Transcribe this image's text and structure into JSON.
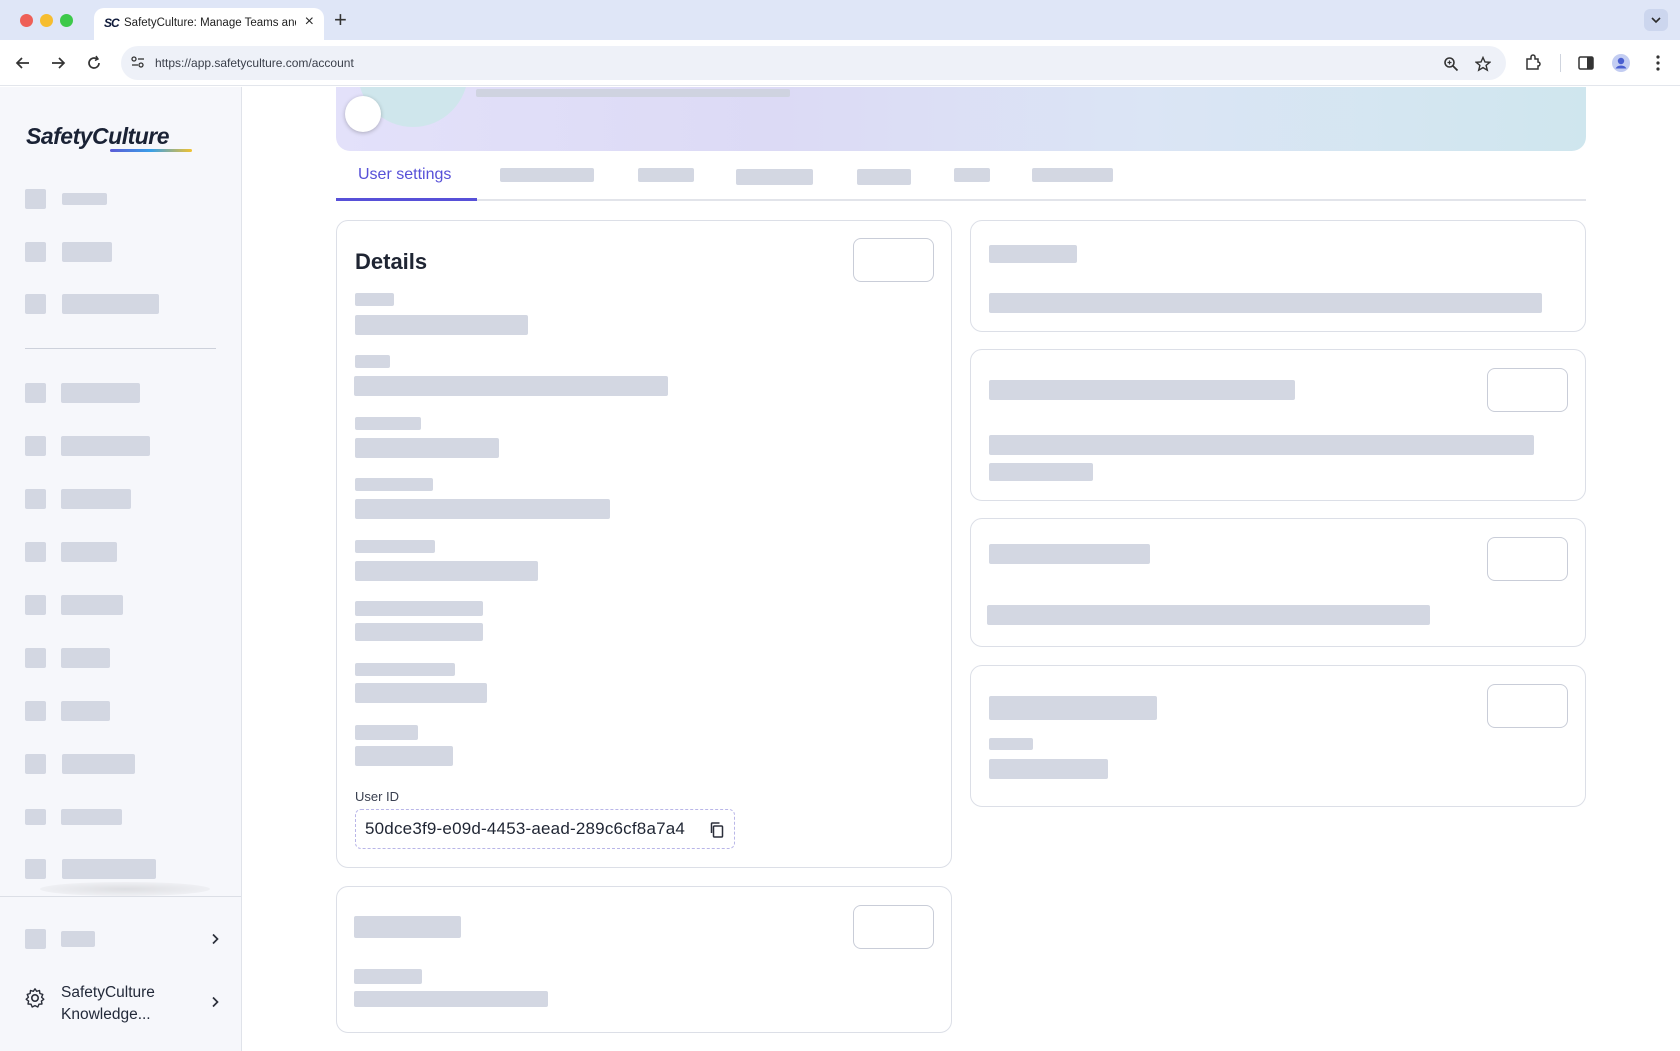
{
  "browser": {
    "tab_title": "SafetyCulture: Manage Teams and...",
    "tab_favicon": "SC",
    "url": "https://app.safetyculture.com/account",
    "icons": [
      "back-arrow-icon",
      "forward-arrow-icon",
      "reload-icon",
      "site-settings-icon",
      "zoom-icon",
      "bookmark-star-icon",
      "extensions-icon",
      "side-panel-icon",
      "profile-icon",
      "more-menu-icon"
    ]
  },
  "sidebar": {
    "logo_text": "SafetyCulture",
    "knowledge_label": "SafetyCulture Knowledge..."
  },
  "main": {
    "active_tab": "User settings",
    "details": {
      "title": "Details",
      "user_id_label": "User ID",
      "user_id_value": "50dce3f9-e09d-4453-aead-289c6cf8a7a4"
    }
  },
  "colors": {
    "accent": "#5750d8",
    "skeleton": "#d3d7e2",
    "sidebar_bg": "#f6f7fb"
  }
}
